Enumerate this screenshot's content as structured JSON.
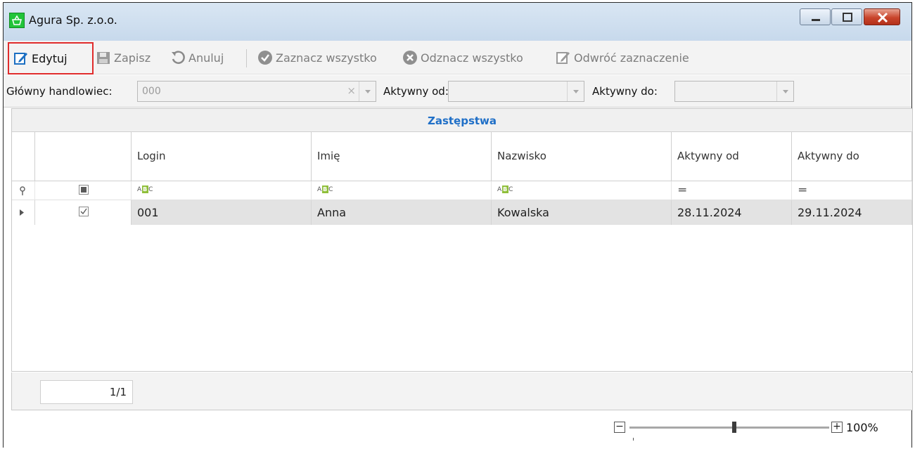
{
  "window": {
    "title": "Agura Sp. z.o.o."
  },
  "toolbar": {
    "edit_label": "Edytuj",
    "save_label": "Zapisz",
    "cancel_label": "Anuluj",
    "select_all_label": "Zaznacz wszystko",
    "deselect_all_label": "Odznacz wszystko",
    "invert_label": "Odwróć zaznaczenie"
  },
  "filters": {
    "main_rep_label": "Główny handlowiec:",
    "main_rep_value": "000",
    "active_from_label": "Aktywny od:",
    "active_from_value": "",
    "active_to_label": "Aktywny do:",
    "active_to_value": ""
  },
  "grid": {
    "group_title": "Zastępstwa",
    "columns": [
      "Login",
      "Imię",
      "Nazwisko",
      "Aktywny od",
      "Aktywny do"
    ],
    "rows": [
      {
        "checked": true,
        "login": "001",
        "first_name": "Anna",
        "last_name": "Kowalska",
        "active_from": "28.11.2024",
        "active_to": "29.11.2024"
      }
    ]
  },
  "pager": {
    "text": "1/1"
  },
  "zoom": {
    "level": "100%",
    "minus": "−",
    "plus": "+"
  },
  "colors": {
    "accent": "#1f6fc7",
    "highlight": "#e02c2c"
  },
  "icons": {
    "edit": "pencil-edit-icon",
    "save": "floppy-disk-icon",
    "cancel": "undo-icon",
    "select_all": "check-circle-icon",
    "deselect_all": "x-circle-icon",
    "invert": "pencil-edit-icon"
  }
}
